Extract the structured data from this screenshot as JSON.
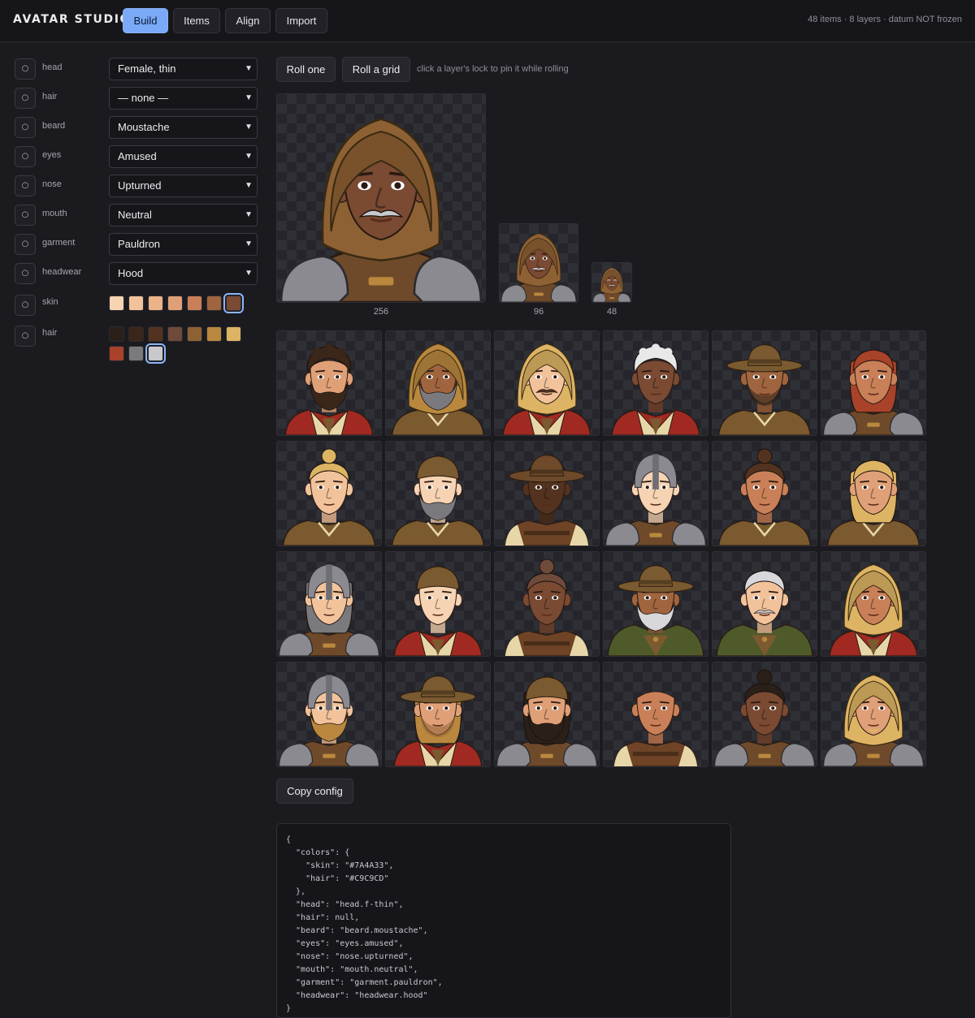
{
  "header": {
    "brand": "AVATAR STUDIO",
    "tabs": [
      {
        "label": "Build",
        "active": true
      },
      {
        "label": "Items",
        "active": false
      },
      {
        "label": "Align",
        "active": false
      },
      {
        "label": "Import",
        "active": false
      }
    ],
    "status": "48 items · 8 layers · datum NOT frozen"
  },
  "layers": [
    {
      "lock_icon": "○",
      "label": "head",
      "value": "Female, thin"
    },
    {
      "lock_icon": "○",
      "label": "hair",
      "value": "— none —"
    },
    {
      "lock_icon": "○",
      "label": "beard",
      "value": "Moustache"
    },
    {
      "lock_icon": "○",
      "label": "eyes",
      "value": "Amused"
    },
    {
      "lock_icon": "○",
      "label": "nose",
      "value": "Upturned"
    },
    {
      "lock_icon": "○",
      "label": "mouth",
      "value": "Neutral"
    },
    {
      "lock_icon": "○",
      "label": "garment",
      "value": "Pauldron"
    },
    {
      "lock_icon": "○",
      "label": "headwear",
      "value": "Hood"
    }
  ],
  "palettes": {
    "skin": {
      "lock_icon": "○",
      "label": "skin",
      "colors": [
        "#F6D3B3",
        "#F2C39B",
        "#ECB388",
        "#E0A077",
        "#C98058",
        "#A0653F",
        "#7A4A33"
      ],
      "selected": "#7A4A33"
    },
    "hair": {
      "lock_icon": "○",
      "label": "hair",
      "colors": [
        "#2A2019",
        "#3A271A",
        "#53331F",
        "#6E4A3A",
        "#8E6134",
        "#B9883E",
        "#DDB464",
        "#A8432A",
        "#7A7A7E",
        "#C9C9CD"
      ],
      "selected": "#C9C9CD"
    }
  },
  "actions": {
    "roll_one": "Roll one",
    "roll_grid": "Roll a grid",
    "hint": "click a layer's lock to pin it while rolling",
    "copy_config": "Copy config"
  },
  "previews": [
    {
      "size_label": "256"
    },
    {
      "size_label": "96"
    },
    {
      "size_label": "48"
    }
  ],
  "grid": [
    {
      "skin": "#E0A077",
      "hair": "#3A271A",
      "hairStyle": "curly",
      "beard": "full",
      "beardColor": "#3A271A",
      "headwear": "none",
      "hwColor": "",
      "garment": "red-vest"
    },
    {
      "skin": "#A0653F",
      "hair": "",
      "hairStyle": "none",
      "beard": "full",
      "beardColor": "#7A7A7E",
      "headwear": "hood-fur",
      "hwColor": "#B9883E",
      "garment": "tunic"
    },
    {
      "skin": "#F2C39B",
      "hair": "",
      "hairStyle": "none",
      "beard": "moustache",
      "beardColor": "#53331F",
      "headwear": "hood-fur",
      "hwColor": "#DDB464",
      "garment": "red-vest"
    },
    {
      "skin": "#7A4A33",
      "hair": "#E8E8E8",
      "hairStyle": "curly",
      "beard": "none",
      "beardColor": "",
      "headwear": "none",
      "hwColor": "",
      "garment": "red-vest"
    },
    {
      "skin": "#A0653F",
      "hair": "",
      "hairStyle": "none",
      "beard": "stubble",
      "beardColor": "#2A2019",
      "headwear": "widebrim",
      "hwColor": "#7A5A30",
      "garment": "tunic"
    },
    {
      "skin": "#C98058",
      "hair": "#A8432A",
      "hairStyle": "long",
      "beard": "none",
      "beardColor": "",
      "headwear": "none",
      "hwColor": "",
      "garment": "pauldron"
    },
    {
      "skin": "#F2C39B",
      "hair": "#DDB464",
      "hairStyle": "bun",
      "beard": "none",
      "beardColor": "",
      "headwear": "none",
      "hwColor": "",
      "garment": "tunic"
    },
    {
      "skin": "#F6D3B3",
      "hair": "",
      "hairStyle": "none",
      "beard": "full",
      "beardColor": "#7A7A7E",
      "headwear": "cap",
      "hwColor": "#7A5A30",
      "garment": "tunic"
    },
    {
      "skin": "#53331F",
      "hair": "#2A2019",
      "hairStyle": "short",
      "beard": "none",
      "beardColor": "",
      "headwear": "widebrim",
      "hwColor": "#6E4A2A",
      "garment": "leather"
    },
    {
      "skin": "#F6D3B3",
      "hair": "",
      "hairStyle": "none",
      "beard": "none",
      "beardColor": "",
      "headwear": "helmet",
      "hwColor": "#8A8A90",
      "garment": "pauldron"
    },
    {
      "skin": "#C98058",
      "hair": "#53331F",
      "hairStyle": "bun",
      "beard": "none",
      "beardColor": "",
      "headwear": "none",
      "hwColor": "",
      "garment": "tunic"
    },
    {
      "skin": "#E0A077",
      "hair": "#DDB464",
      "hairStyle": "long",
      "beard": "none",
      "beardColor": "",
      "headwear": "none",
      "hwColor": "",
      "garment": "tunic"
    },
    {
      "skin": "#F2C39B",
      "hair": "#7A7A7E",
      "hairStyle": "long",
      "beard": "none",
      "beardColor": "",
      "headwear": "helmet",
      "hwColor": "#8A8A90",
      "garment": "pauldron"
    },
    {
      "skin": "#F6D3B3",
      "hair": "",
      "hairStyle": "none",
      "beard": "none",
      "beardColor": "",
      "headwear": "cap",
      "hwColor": "#7A5A30",
      "garment": "red-vest"
    },
    {
      "skin": "#7A4A33",
      "hair": "#6E4A3A",
      "hairStyle": "braid",
      "beard": "none",
      "beardColor": "",
      "headwear": "none",
      "hwColor": "",
      "garment": "leather"
    },
    {
      "skin": "#A0653F",
      "hair": "",
      "hairStyle": "none",
      "beard": "full",
      "beardColor": "#D8D8DC",
      "headwear": "widebrim",
      "hwColor": "#7A5A30",
      "garment": "green-cloak"
    },
    {
      "skin": "#F2C39B",
      "hair": "#D8D8DC",
      "hairStyle": "short",
      "beard": "moustache",
      "beardColor": "#C9C9CD",
      "headwear": "none",
      "hwColor": "",
      "garment": "green-cloak"
    },
    {
      "skin": "#C98058",
      "hair": "",
      "hairStyle": "none",
      "beard": "none",
      "beardColor": "",
      "headwear": "hood-fur",
      "hwColor": "#DDB464",
      "garment": "red-vest"
    },
    {
      "skin": "#F2C39B",
      "hair": "",
      "hairStyle": "none",
      "beard": "full",
      "beardColor": "#B9883E",
      "headwear": "helmet",
      "hwColor": "#8A8A90",
      "garment": "pauldron"
    },
    {
      "skin": "#E0A077",
      "hair": "#B9883E",
      "hairStyle": "long",
      "beard": "stubble",
      "beardColor": "#8E6134",
      "headwear": "widebrim",
      "hwColor": "#7A5A30",
      "garment": "red-vest"
    },
    {
      "skin": "#E0A077",
      "hair": "#2A2019",
      "hairStyle": "long",
      "beard": "full",
      "beardColor": "#2A2019",
      "headwear": "cap",
      "hwColor": "#7A5A30",
      "garment": "pauldron"
    },
    {
      "skin": "#C98058",
      "hair": "",
      "hairStyle": "none",
      "beard": "none",
      "beardColor": "",
      "headwear": "none",
      "hwColor": "",
      "garment": "leather"
    },
    {
      "skin": "#7A4A33",
      "hair": "#2A2019",
      "hairStyle": "bun",
      "beard": "none",
      "beardColor": "",
      "headwear": "none",
      "hwColor": "",
      "garment": "pauldron"
    },
    {
      "skin": "#E0A077",
      "hair": "",
      "hairStyle": "none",
      "beard": "goatee",
      "beardColor": "#DDB464",
      "headwear": "hood-fur",
      "hwColor": "#DDB464",
      "garment": "pauldron"
    }
  ],
  "config_text": "{\n  \"colors\": {\n    \"skin\": \"#7A4A33\",\n    \"hair\": \"#C9C9CD\"\n  },\n  \"head\": \"head.f-thin\",\n  \"hair\": null,\n  \"beard\": \"beard.moustache\",\n  \"eyes\": \"eyes.amused\",\n  \"nose\": \"nose.upturned\",\n  \"mouth\": \"mouth.neutral\",\n  \"garment\": \"garment.pauldron\",\n  \"headwear\": \"headwear.hood\"\n}"
}
